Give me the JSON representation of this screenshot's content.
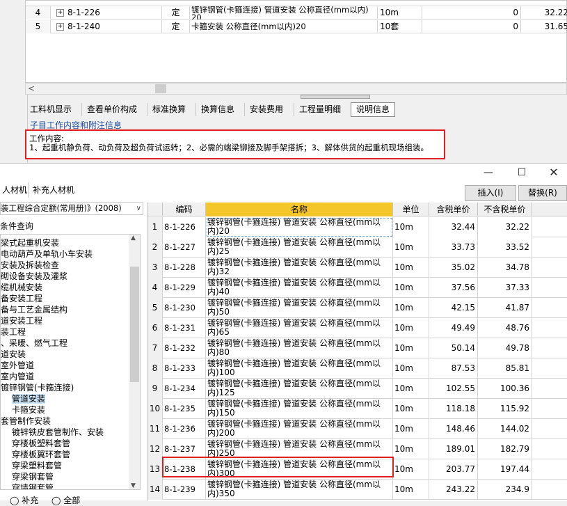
{
  "top_table": {
    "rows": [
      {
        "num": "4",
        "code": "8-1-226",
        "type": "定",
        "name": "镀锌钢管(卡箍连接) 管道安装 公称直径(mm以内) 20",
        "unit": "10m",
        "qty": "0",
        "price": "32.22"
      },
      {
        "num": "5",
        "code": "8-1-240",
        "type": "定",
        "name": "卡箍安装 公称直径(mm以内)20",
        "unit": "10套",
        "qty": "0",
        "price": "31.65"
      }
    ]
  },
  "tabs": [
    "工料机显示",
    "查看单价构成",
    "标准换算",
    "换算信息",
    "安装费用",
    "工程量明细",
    "说明信息"
  ],
  "active_tab": "说明信息",
  "ref_info": {
    "title": "子目工作内容和附注信息",
    "content_label": "工作内容:",
    "content_text": "1、起重机静负荷、动负荷及超负荷试运转；2、必需的端梁铆接及脚手架搭拆；3、解体供货的起重机现场组装。"
  },
  "dialog": {
    "sub_tabs": [
      "人材机",
      "补充人材机"
    ],
    "insert_label": "插入(I)",
    "replace_label": "替换(R)",
    "library": "装工程综合定额(常用册)》(2008)",
    "condition_query": "条件查询",
    "tree": [
      {
        "label": "梁式起重机安装",
        "indent": 0
      },
      {
        "label": "电动葫芦及单轨小车安装",
        "indent": 0
      },
      {
        "label": "安装及拆装检查",
        "indent": 0
      },
      {
        "label": "砌设备安装及灌浆",
        "indent": 0
      },
      {
        "label": "缆机械安装",
        "indent": 0
      },
      {
        "label": "备安装工程",
        "indent": 0
      },
      {
        "label": "备与工艺金属结构",
        "indent": 0
      },
      {
        "label": "道安装工程",
        "indent": 0
      },
      {
        "label": "装工程",
        "indent": 0
      },
      {
        "label": "、采暖、燃气工程",
        "indent": 0
      },
      {
        "label": "道安装",
        "indent": 0
      },
      {
        "label": "室外管道",
        "indent": 0
      },
      {
        "label": "室内管道",
        "indent": 0
      },
      {
        "label": "镀锌钢管(卡箍连接)",
        "indent": 0
      },
      {
        "label": "管道安装",
        "indent": 1,
        "selected": true
      },
      {
        "label": "卡箍安装",
        "indent": 1
      },
      {
        "label": "套管制作安装",
        "indent": 0
      },
      {
        "label": "镀锌铁皮套管制作、安装",
        "indent": 1
      },
      {
        "label": "穿楼板塑料套管",
        "indent": 1
      },
      {
        "label": "穿楼板翼环套管",
        "indent": 1
      },
      {
        "label": "穿梁塑料套管",
        "indent": 1
      },
      {
        "label": "穿梁钢套管",
        "indent": 1
      },
      {
        "label": "穿墙钢套管",
        "indent": 1
      }
    ],
    "radio": [
      "补充",
      "全部"
    ],
    "grid": {
      "headers": {
        "code": "编码",
        "name": "名称",
        "unit": "单位",
        "tax": "含税单价",
        "notax": "不含税单价"
      },
      "rows": [
        {
          "num": "1",
          "code": "8-1-226",
          "name": "镀锌钢管(卡箍连接) 管道安装 公称直径(mm以内)20",
          "unit": "10m",
          "tax": "32.44",
          "notax": "32.22"
        },
        {
          "num": "2",
          "code": "8-1-227",
          "name": "镀锌钢管(卡箍连接) 管道安装 公称直径(mm以内)25",
          "unit": "10m",
          "tax": "33.73",
          "notax": "33.52"
        },
        {
          "num": "3",
          "code": "8-1-228",
          "name": "镀锌钢管(卡箍连接) 管道安装 公称直径(mm以内)32",
          "unit": "10m",
          "tax": "35.02",
          "notax": "34.78"
        },
        {
          "num": "4",
          "code": "8-1-229",
          "name": "镀锌钢管(卡箍连接) 管道安装 公称直径(mm以内)40",
          "unit": "10m",
          "tax": "37.56",
          "notax": "37.33"
        },
        {
          "num": "5",
          "code": "8-1-230",
          "name": "镀锌钢管(卡箍连接) 管道安装 公称直径(mm以内)50",
          "unit": "10m",
          "tax": "42.15",
          "notax": "41.87"
        },
        {
          "num": "6",
          "code": "8-1-231",
          "name": "镀锌钢管(卡箍连接) 管道安装 公称直径(mm以内)65",
          "unit": "10m",
          "tax": "49.49",
          "notax": "48.76"
        },
        {
          "num": "7",
          "code": "8-1-232",
          "name": "镀锌钢管(卡箍连接) 管道安装 公称直径(mm以内)80",
          "unit": "10m",
          "tax": "50.14",
          "notax": "49.78"
        },
        {
          "num": "8",
          "code": "8-1-233",
          "name": "镀锌钢管(卡箍连接) 管道安装 公称直径(mm以内)100",
          "unit": "10m",
          "tax": "87.53",
          "notax": "85.81"
        },
        {
          "num": "9",
          "code": "8-1-234",
          "name": "镀锌钢管(卡箍连接) 管道安装 公称直径(mm以内)125",
          "unit": "10m",
          "tax": "102.55",
          "notax": "100.36"
        },
        {
          "num": "10",
          "code": "8-1-235",
          "name": "镀锌钢管(卡箍连接) 管道安装 公称直径(mm以内)150",
          "unit": "10m",
          "tax": "118.18",
          "notax": "115.92"
        },
        {
          "num": "11",
          "code": "8-1-236",
          "name": "镀锌钢管(卡箍连接) 管道安装 公称直径(mm以内)200",
          "unit": "10m",
          "tax": "148.46",
          "notax": "144.02"
        },
        {
          "num": "12",
          "code": "8-1-237",
          "name": "镀锌钢管(卡箍连接) 管道安装 公称直径(mm以内)250",
          "unit": "10m",
          "tax": "189.01",
          "notax": "182.79"
        },
        {
          "num": "13",
          "code": "8-1-238",
          "name": "镀锌钢管(卡箍连接) 管道安装 公称直径(mm以内)300",
          "unit": "10m",
          "tax": "203.77",
          "notax": "197.44"
        },
        {
          "num": "14",
          "code": "8-1-239",
          "name": "镀锌钢管(卡箍连接) 管道安装 公称直径(mm以内)350",
          "unit": "10m",
          "tax": "243.22",
          "notax": "234.9"
        }
      ]
    }
  }
}
